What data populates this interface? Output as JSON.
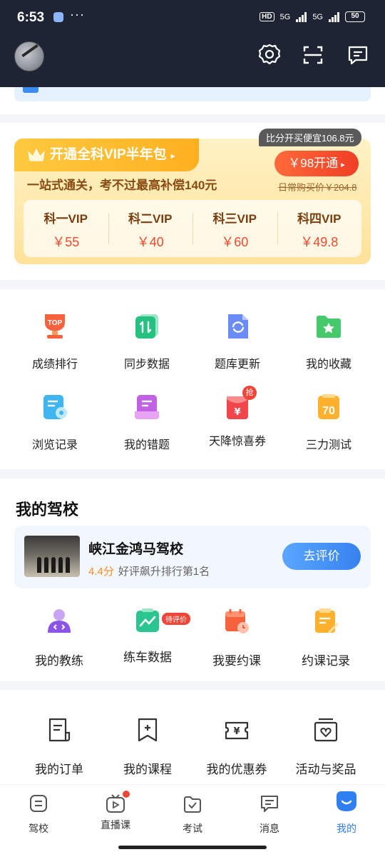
{
  "status_bar": {
    "time": "6:53",
    "dots": "···",
    "hd": "HD",
    "net1": "5G",
    "net2": "5G",
    "battery": "50"
  },
  "header": {
    "avatar": "avatar",
    "icons": [
      "settings-icon",
      "scan-icon",
      "message-icon"
    ]
  },
  "vip": {
    "title": "开通全科VIP半年包",
    "title_arrow": "▸",
    "subtitle": "一站式通关，考不过最高补偿140元",
    "bubble": "比分开买便宜106.8元",
    "button": "￥98开通",
    "button_arrow": "▸",
    "original_price": "日常购买价￥204.8",
    "items": [
      {
        "name": "科一VIP",
        "price": "￥55"
      },
      {
        "name": "科二VIP",
        "price": "￥40"
      },
      {
        "name": "科三VIP",
        "price": "￥60"
      },
      {
        "name": "科四VIP",
        "price": "￥49.8"
      }
    ]
  },
  "tools": [
    {
      "label": "成绩排行",
      "icon": "trophy-top-icon"
    },
    {
      "label": "同步数据",
      "icon": "sync-data-icon"
    },
    {
      "label": "题库更新",
      "icon": "refresh-doc-icon"
    },
    {
      "label": "我的收藏",
      "icon": "star-folder-icon"
    },
    {
      "label": "浏览记录",
      "icon": "history-eye-icon"
    },
    {
      "label": "我的错题",
      "icon": "wrong-questions-icon"
    },
    {
      "label": "天降惊喜券",
      "icon": "red-envelope-icon",
      "badge": "抢"
    },
    {
      "label": "三力测试",
      "icon": "test-70-icon",
      "icon_text": "70"
    }
  ],
  "school": {
    "section_title": "我的驾校",
    "name": "峡江金鸿马驾校",
    "rating": "4.4分",
    "rank_text": "好评飙升排行第1名",
    "button": "去评价",
    "tools": [
      {
        "label": "我的教练",
        "icon": "coach-icon"
      },
      {
        "label": "练车数据",
        "icon": "practice-data-icon",
        "tag": "待评价"
      },
      {
        "label": "我要约课",
        "icon": "book-lesson-icon"
      },
      {
        "label": "约课记录",
        "icon": "booking-record-icon"
      }
    ]
  },
  "orders": [
    {
      "label": "我的订单",
      "icon": "order-icon"
    },
    {
      "label": "我的课程",
      "icon": "course-icon"
    },
    {
      "label": "我的优惠券",
      "icon": "coupon-icon"
    },
    {
      "label": "活动与奖品",
      "icon": "gift-icon"
    }
  ],
  "tabbar": [
    {
      "label": "驾校",
      "icon": "school-tab-icon"
    },
    {
      "label": "直播课",
      "icon": "live-tab-icon",
      "dot": true
    },
    {
      "label": "考试",
      "icon": "exam-tab-icon"
    },
    {
      "label": "消息",
      "icon": "message-tab-icon"
    },
    {
      "label": "我的",
      "icon": "me-tab-icon",
      "active": true
    }
  ],
  "colors": {
    "header_bg": "#1e2434",
    "accent_blue": "#2f7ff0",
    "price_red": "#f04a30",
    "gold": "#ffb020"
  }
}
